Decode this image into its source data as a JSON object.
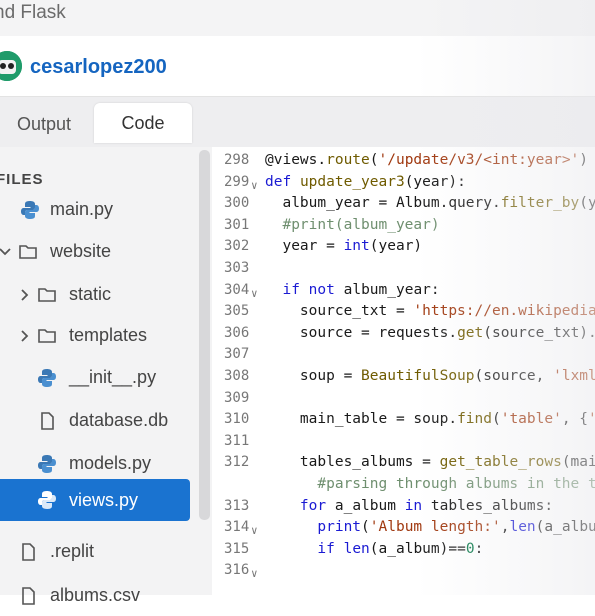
{
  "header": {
    "project_title": "nd Flask",
    "username": "cesarlopez200"
  },
  "tabs": [
    {
      "label": "Output"
    },
    {
      "label": "Code"
    }
  ],
  "sidebar": {
    "files_label": "FILES",
    "items": [
      {
        "label": "main.py",
        "icon": "python-icon"
      },
      {
        "label": "website",
        "icon": "folder-icon",
        "chevron": "chevron-down-icon"
      },
      {
        "label": "static",
        "icon": "folder-icon",
        "chevron": "chevron-right-icon"
      },
      {
        "label": "templates",
        "icon": "folder-icon",
        "chevron": "chevron-right-icon"
      },
      {
        "label": "__init__.py",
        "icon": "python-icon"
      },
      {
        "label": "database.db",
        "icon": "file-icon"
      },
      {
        "label": "models.py",
        "icon": "python-icon"
      },
      {
        "label": "views.py",
        "icon": "python-icon",
        "active": true
      },
      {
        "label": ".replit",
        "icon": "file-icon"
      },
      {
        "label": "albums.csv",
        "icon": "file-icon"
      }
    ]
  },
  "code": {
    "lines": [
      {
        "num": "298",
        "text": "@views.route('/update/v3/<int:year>')"
      },
      {
        "num": "299",
        "text": "def update_year3(year):",
        "fold": true
      },
      {
        "num": "300",
        "text": "  album_year = Album.query.filter_by(year=year"
      },
      {
        "num": "301",
        "text": "  #print(album_year)"
      },
      {
        "num": "302",
        "text": "  year = int(year)"
      },
      {
        "num": "303",
        "text": ""
      },
      {
        "num": "304",
        "text": "  if not album_year:",
        "fold": true
      },
      {
        "num": "305",
        "text": "    source_txt = 'https://en.wikipedia.org/wi"
      },
      {
        "num": "306",
        "text": "    source = requests.get(source_txt).text"
      },
      {
        "num": "307",
        "text": ""
      },
      {
        "num": "308",
        "text": "    soup = BeautifulSoup(source, 'lxml')"
      },
      {
        "num": "309",
        "text": ""
      },
      {
        "num": "310",
        "text": "    main_table = soup.find('table', {'class'"
      },
      {
        "num": "311",
        "text": ""
      },
      {
        "num": "312",
        "text": "    tables_albums = get_table_rows(main_table"
      },
      {
        "num": "",
        "text": "      #parsing through albums in the table"
      },
      {
        "num": "313",
        "text": "    for a_album in tables_albums:"
      },
      {
        "num": "314",
        "text": "      print('Album length:',len(a_album))",
        "fold": true
      },
      {
        "num": "315",
        "text": "      if len(a_album)==0:"
      },
      {
        "num": "316",
        "text": "",
        "fold": true
      }
    ]
  },
  "colors": {
    "accent": "#1a73d0",
    "username": "#1565c0",
    "keyword": "#1b1bd3",
    "string": "#a0380f"
  }
}
